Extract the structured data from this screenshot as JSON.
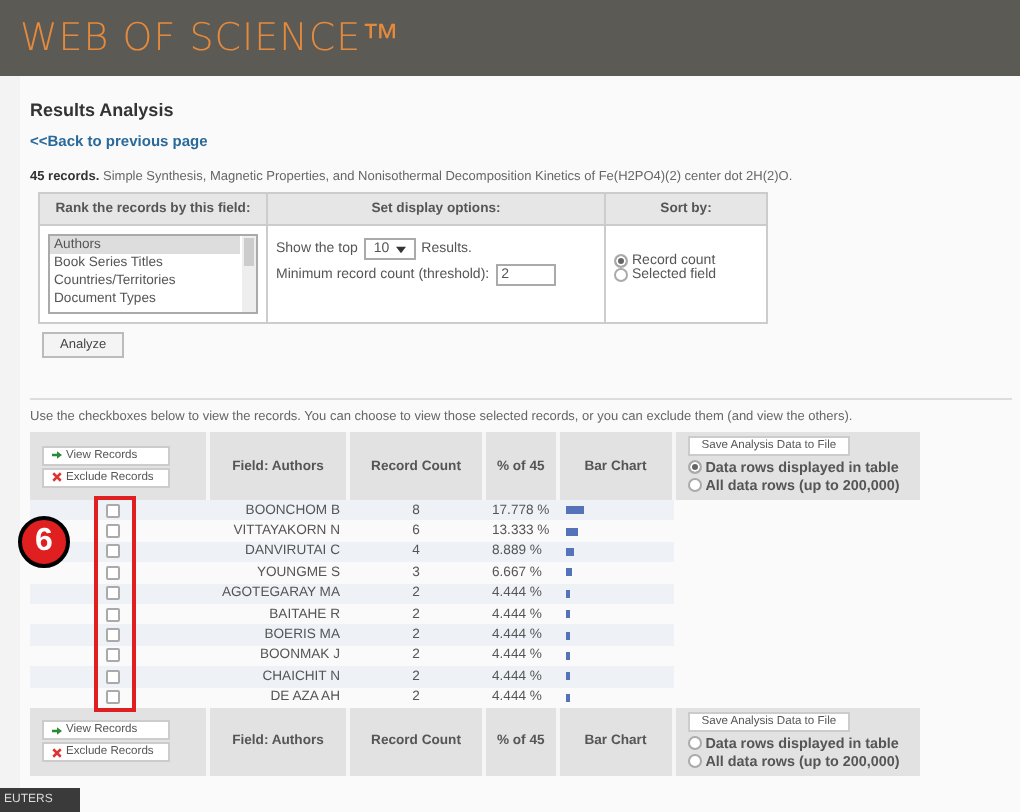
{
  "header": {
    "logo": "WEB OF SCIENCE™"
  },
  "title": "Results Analysis",
  "back_link": "<<Back to previous page",
  "summary": "**45 records.** Simple Synthesis, Magnetic Properties, and Nonisothermal Decomposition Kinetics of Fe(H2PO4)(2) center dot 2H(2)O.",
  "options": {
    "rank_heading": "Rank the records by this field:",
    "display_heading": "Set display options:",
    "sort_heading": "Sort by:",
    "fields": [
      {
        "label": "Authors",
        "selected": true
      },
      {
        "label": "Book Series Titles",
        "selected": false
      },
      {
        "label": "Countries/Territories",
        "selected": false
      },
      {
        "label": "Document Types",
        "selected": false
      }
    ],
    "show_top_label": "Show the top",
    "show_top_value": "10",
    "results_label": "Results.",
    "threshold_label": "Minimum record count (threshold):",
    "threshold_value": "2",
    "sort_options": [
      {
        "label": "Record count",
        "selected": true
      },
      {
        "label": "Selected field",
        "selected": false
      }
    ],
    "analyze_button": "Analyze"
  },
  "instructions": "Use the checkboxes below to view the records. You can choose to view those selected records, or you can exclude them (and view the others).",
  "header_bars": [
    {
      "view_button": "View Records",
      "exclude_button": "Exclude Records",
      "columns": [
        "Field: Authors",
        "Record Count",
        "% of 45",
        "Bar Chart"
      ],
      "save_button": "Save Analysis Data to File",
      "save_options": [
        {
          "label": "Data rows displayed in table",
          "selected": true
        },
        {
          "label": "All data rows (up to 200,000)",
          "selected": false
        }
      ]
    },
    {
      "view_button": "View Records",
      "exclude_button": "Exclude Records",
      "columns": [
        "Field: Authors",
        "Record Count",
        "% of 45",
        "Bar Chart"
      ],
      "save_button": "Save Analysis Data to File",
      "save_options": [
        {
          "label": "Data rows displayed in table",
          "selected": false
        },
        {
          "label": "All data rows (up to 200,000)",
          "selected": false
        }
      ]
    }
  ],
  "rows": [
    {
      "author": "BOONCHOM B",
      "count": "8",
      "percent": "17.778 %",
      "level": 0.178,
      "checked": false
    },
    {
      "author": "VITTAYAKORN N",
      "count": "6",
      "percent": "13.333 %",
      "level": 0.133,
      "checked": false
    },
    {
      "author": "DANVIRUTAI C",
      "count": "4",
      "percent": "8.889 %",
      "level": 0.089,
      "checked": false
    },
    {
      "author": "YOUNGME S",
      "count": "3",
      "percent": "6.667 %",
      "level": 0.067,
      "checked": false
    },
    {
      "author": "AGOTEGARAY MA",
      "count": "2",
      "percent": "4.444 %",
      "level": 0.044,
      "checked": false
    },
    {
      "author": "BAITAHE R",
      "count": "2",
      "percent": "4.444 %",
      "level": 0.044,
      "checked": false
    },
    {
      "author": "BOERIS MA",
      "count": "2",
      "percent": "4.444 %",
      "level": 0.044,
      "checked": false
    },
    {
      "author": "BOONMAK J",
      "count": "2",
      "percent": "4.444 %",
      "level": 0.044,
      "checked": false
    },
    {
      "author": "CHAICHIT N",
      "count": "2",
      "percent": "4.444 %",
      "level": 0.044,
      "checked": false
    },
    {
      "author": "DE AZA AH",
      "count": "2",
      "percent": "4.444 %",
      "level": 0.044,
      "checked": false
    }
  ],
  "callout": {
    "number": "6"
  },
  "footer_logo": "EUTERS"
}
